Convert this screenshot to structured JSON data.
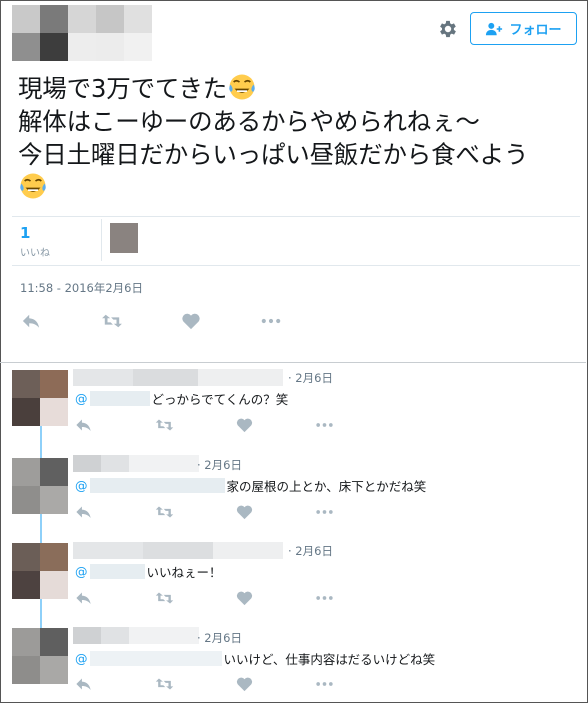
{
  "header": {
    "follow_label": "フォロー"
  },
  "icons": {
    "gear": "gear-icon",
    "follow": "add-user-icon"
  },
  "tweet": {
    "lines": [
      "現場で3万でてきた",
      "解体はこーゆーのあるからやめられねぇ〜",
      "今日土曜日だからいっぱい昼飯だから食べよう"
    ],
    "emoji": "face-with-tears-of-joy-emoji",
    "likes_count": "1",
    "likes_label": "いいね",
    "timestamp": "11:58 - 2016年2月6日"
  },
  "replies": [
    {
      "date": "· 2月6日",
      "at": "@",
      "text": "どっからでてくんの？笑"
    },
    {
      "date": "· 2月6日",
      "at": "@",
      "text": "家の屋根の上とか、床下とかだね笑"
    },
    {
      "date": "· 2月6日",
      "at": "@",
      "text": "いいねぇー！"
    },
    {
      "date": "· 2月6日",
      "at": "@",
      "text": "いいけど、仕事内容はだるいけどね笑"
    }
  ],
  "colors": {
    "accent": "#1da1f2",
    "thread_line": "#8ed0f9",
    "action_icon": "#aab8c2"
  }
}
